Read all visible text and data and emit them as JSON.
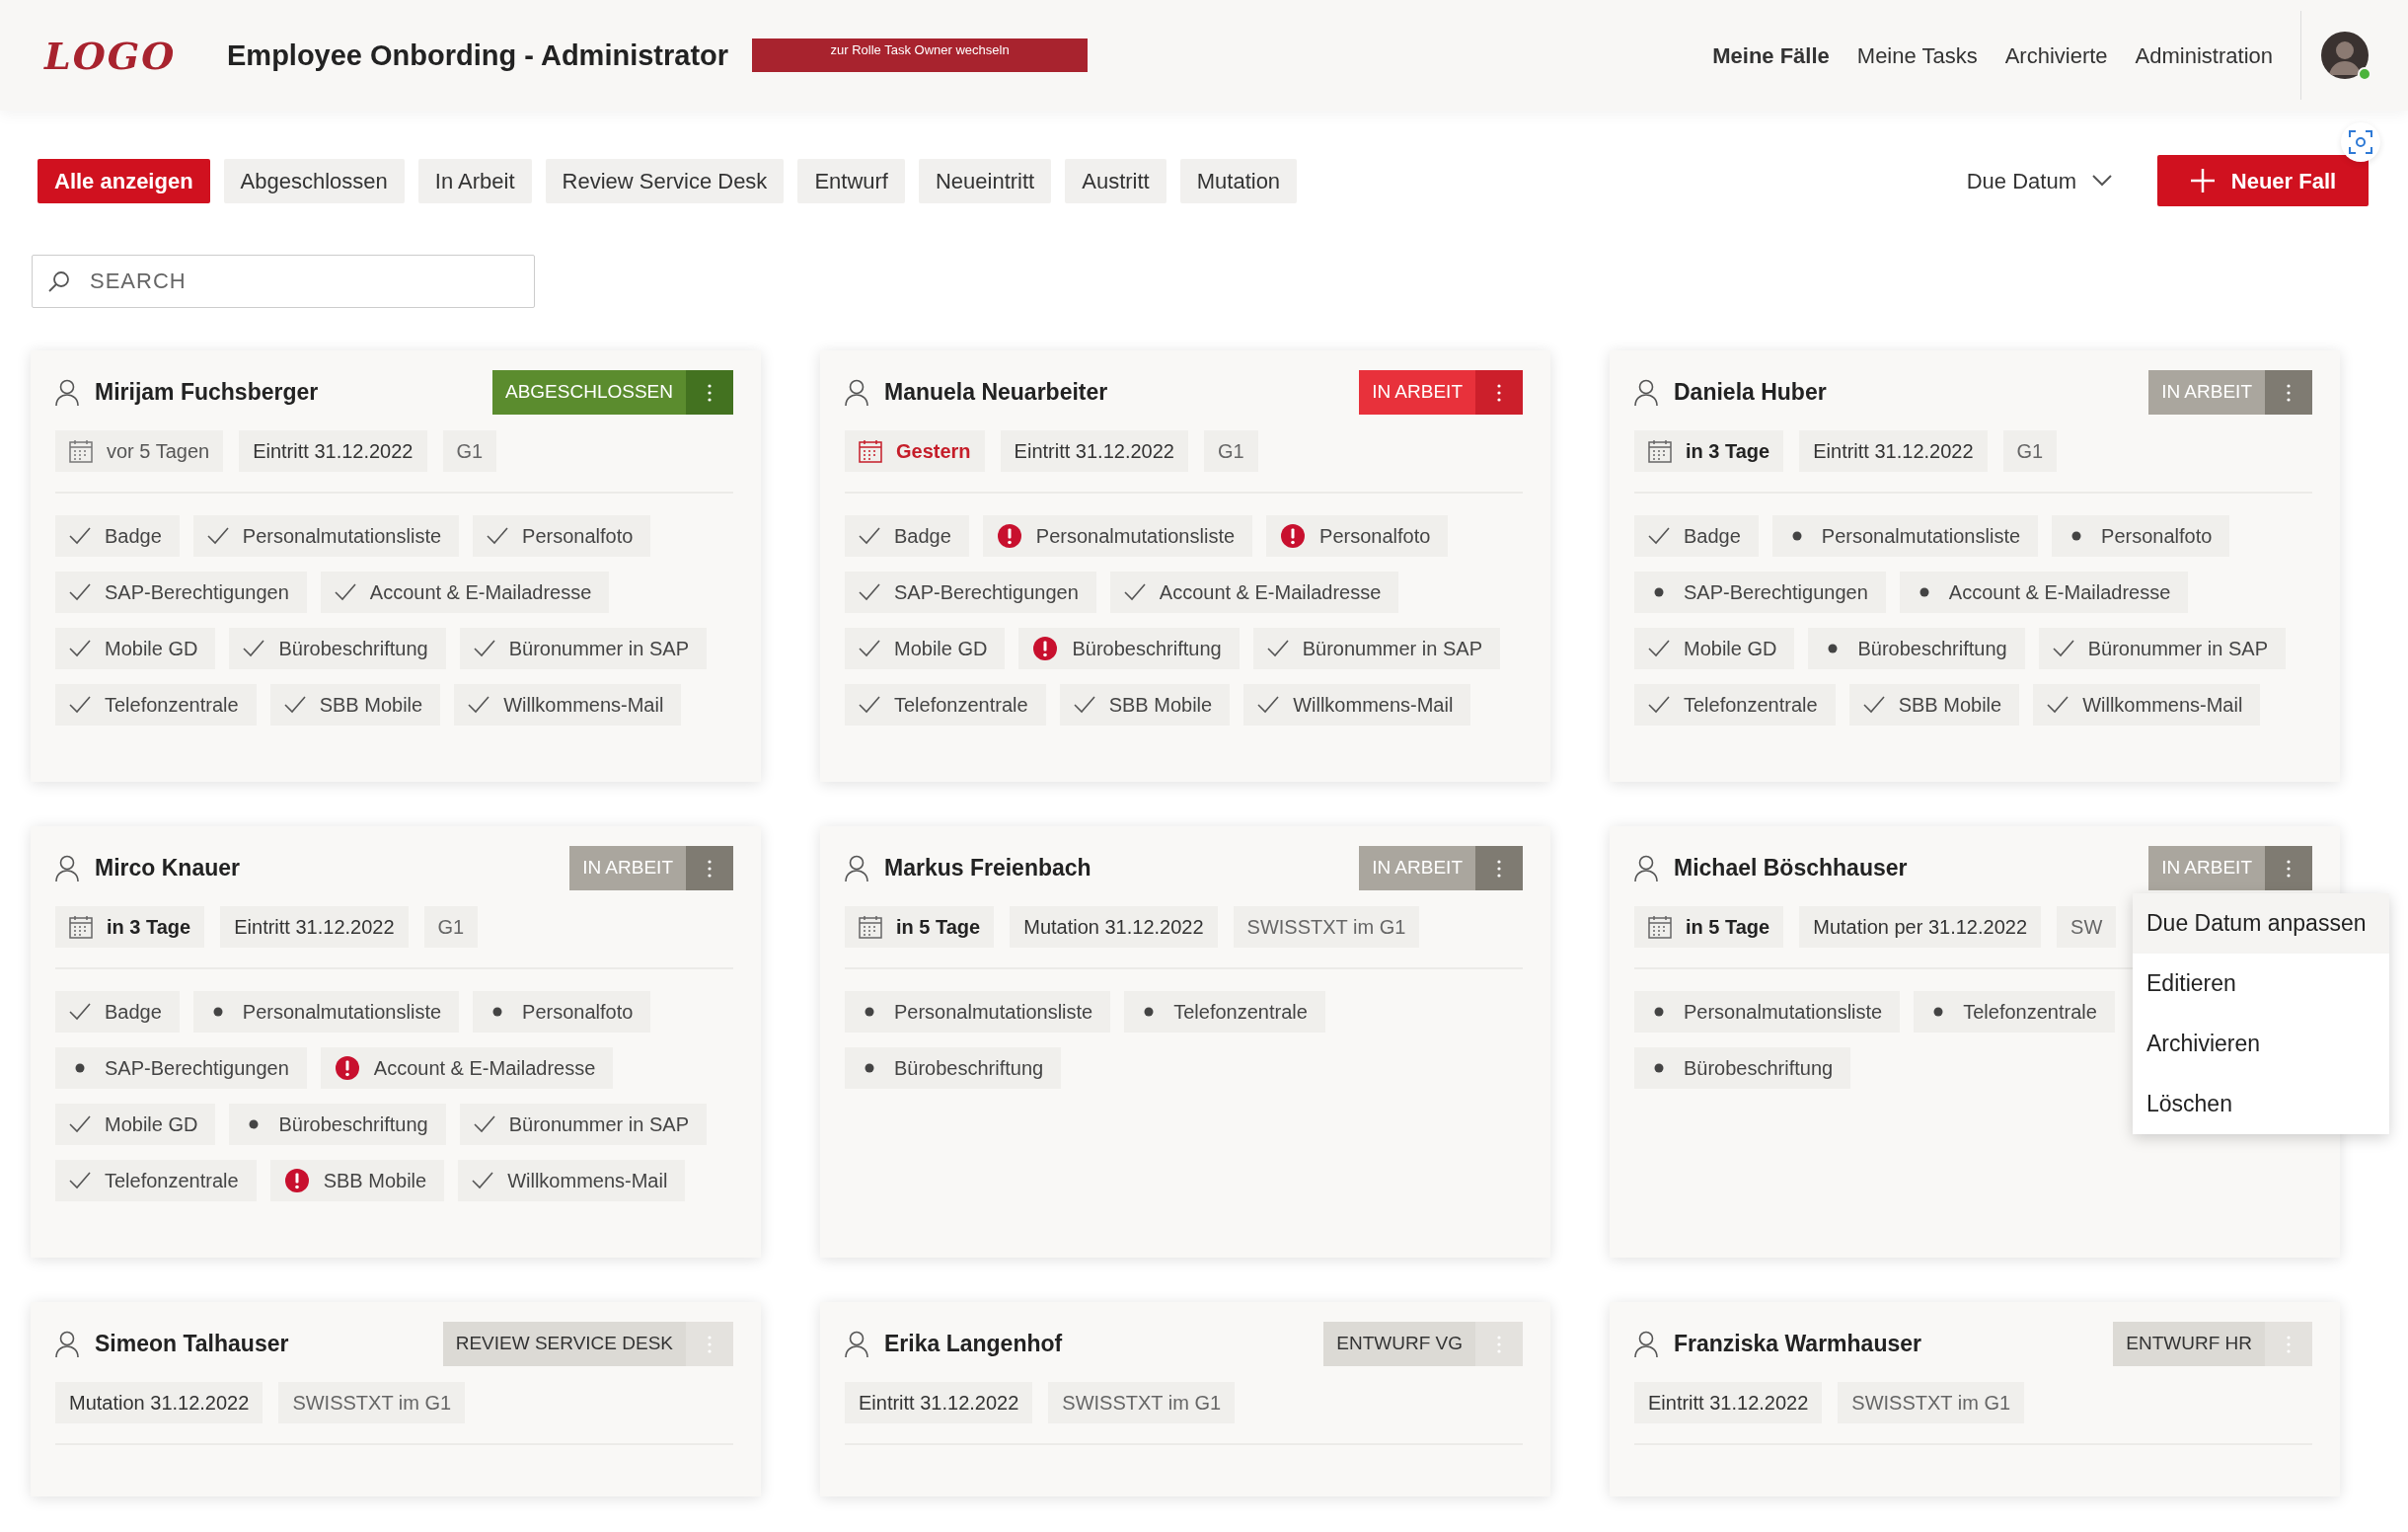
{
  "header": {
    "logo": "LOGO",
    "title": "Employee Onbording - Administrator",
    "role_button": "zur Rolle Task Owner wechseln",
    "nav": [
      {
        "label": "Meine Fälle",
        "selected": true
      },
      {
        "label": "Meine Tasks",
        "selected": false
      },
      {
        "label": "Archivierte",
        "selected": false
      },
      {
        "label": "Administration",
        "selected": false
      }
    ],
    "user_online": true
  },
  "filters": [
    {
      "label": "Alle anzeigen",
      "selected": true
    },
    {
      "label": "Abgeschlossen",
      "selected": false
    },
    {
      "label": "In Arbeit",
      "selected": false
    },
    {
      "label": "Review Service Desk",
      "selected": false
    },
    {
      "label": "Entwurf",
      "selected": false
    },
    {
      "label": "Neueintritt",
      "selected": false
    },
    {
      "label": "Austritt",
      "selected": false
    },
    {
      "label": "Mutation",
      "selected": false
    }
  ],
  "sort": {
    "label": "Due Datum"
  },
  "new_button": {
    "label": "Neuer Fall"
  },
  "search": {
    "placeholder": "SEARCH"
  },
  "cases": [
    {
      "name": "Mirijam Fuchsberger",
      "status": {
        "label": "ABGESCHLOSSEN",
        "kind": "done"
      },
      "due": {
        "text": "vor 5 Tagen",
        "kind": "past"
      },
      "meta": [
        {
          "text": "Eintritt 31.12.2022",
          "muted": false
        },
        {
          "text": "G1",
          "muted": true
        }
      ],
      "tasks": [
        {
          "label": "Badge",
          "kind": "done"
        },
        {
          "label": "Personalmutationsliste",
          "kind": "done"
        },
        {
          "label": "Personalfoto",
          "kind": "done"
        },
        {
          "label": "SAP-Berechtigungen",
          "kind": "done"
        },
        {
          "label": "Account & E-Mailadresse",
          "kind": "done"
        },
        {
          "label": "Mobile GD",
          "kind": "done"
        },
        {
          "label": "Bürobeschriftung",
          "kind": "done"
        },
        {
          "label": "Büronummer in SAP",
          "kind": "done"
        },
        {
          "label": "Telefonzentrale",
          "kind": "done"
        },
        {
          "label": "SBB Mobile",
          "kind": "done"
        },
        {
          "label": "Willkommens-Mail",
          "kind": "done"
        }
      ]
    },
    {
      "name": "Manuela Neuarbeiter",
      "status": {
        "label": "IN ARBEIT",
        "kind": "urgent"
      },
      "due": {
        "text": "Gestern",
        "kind": "overdue"
      },
      "meta": [
        {
          "text": "Eintritt 31.12.2022",
          "muted": false
        },
        {
          "text": "G1",
          "muted": true
        }
      ],
      "tasks": [
        {
          "label": "Badge",
          "kind": "done"
        },
        {
          "label": "Personalmutationsliste",
          "kind": "alert"
        },
        {
          "label": "Personalfoto",
          "kind": "alert"
        },
        {
          "label": "SAP-Berechtigungen",
          "kind": "done"
        },
        {
          "label": "Account & E-Mailadresse",
          "kind": "done"
        },
        {
          "label": "Mobile GD",
          "kind": "done"
        },
        {
          "label": "Bürobeschriftung",
          "kind": "alert"
        },
        {
          "label": "Büronummer in SAP",
          "kind": "done"
        },
        {
          "label": "Telefonzentrale",
          "kind": "done"
        },
        {
          "label": "SBB Mobile",
          "kind": "done"
        },
        {
          "label": "Willkommens-Mail",
          "kind": "done"
        }
      ]
    },
    {
      "name": "Daniela Huber",
      "status": {
        "label": "IN ARBEIT",
        "kind": "progress"
      },
      "due": {
        "text": "in 3 Tage",
        "kind": "upcoming"
      },
      "meta": [
        {
          "text": "Eintritt 31.12.2022",
          "muted": false
        },
        {
          "text": "G1",
          "muted": true
        }
      ],
      "tasks": [
        {
          "label": "Badge",
          "kind": "done"
        },
        {
          "label": "Personalmutationsliste",
          "kind": "open"
        },
        {
          "label": "Personalfoto",
          "kind": "open"
        },
        {
          "label": "SAP-Berechtigungen",
          "kind": "open"
        },
        {
          "label": "Account & E-Mailadresse",
          "kind": "open"
        },
        {
          "label": "Mobile GD",
          "kind": "done"
        },
        {
          "label": "Bürobeschriftung",
          "kind": "open"
        },
        {
          "label": "Büronummer in SAP",
          "kind": "done"
        },
        {
          "label": "Telefonzentrale",
          "kind": "done"
        },
        {
          "label": "SBB Mobile",
          "kind": "done"
        },
        {
          "label": "Willkommens-Mail",
          "kind": "done"
        }
      ]
    },
    {
      "name": "Mirco Knauer",
      "status": {
        "label": "IN ARBEIT",
        "kind": "progress"
      },
      "due": {
        "text": "in 3 Tage",
        "kind": "upcoming"
      },
      "meta": [
        {
          "text": "Eintritt 31.12.2022",
          "muted": false
        },
        {
          "text": "G1",
          "muted": true
        }
      ],
      "tasks": [
        {
          "label": "Badge",
          "kind": "done"
        },
        {
          "label": "Personalmutationsliste",
          "kind": "open"
        },
        {
          "label": "Personalfoto",
          "kind": "open"
        },
        {
          "label": "SAP-Berechtigungen",
          "kind": "open"
        },
        {
          "label": "Account & E-Mailadresse",
          "kind": "alert"
        },
        {
          "label": "Mobile GD",
          "kind": "done"
        },
        {
          "label": "Bürobeschriftung",
          "kind": "open"
        },
        {
          "label": "Büronummer in SAP",
          "kind": "done"
        },
        {
          "label": "Telefonzentrale",
          "kind": "done"
        },
        {
          "label": "SBB Mobile",
          "kind": "alert"
        },
        {
          "label": "Willkommens-Mail",
          "kind": "done"
        }
      ]
    },
    {
      "name": "Markus Freienbach",
      "status": {
        "label": "IN ARBEIT",
        "kind": "progress"
      },
      "due": {
        "text": "in 5 Tage",
        "kind": "upcoming"
      },
      "meta": [
        {
          "text": "Mutation 31.12.2022",
          "muted": false
        },
        {
          "text": "SWISSTXT im G1",
          "muted": true
        }
      ],
      "tasks": [
        {
          "label": "Personalmutationsliste",
          "kind": "open"
        },
        {
          "label": "Telefonzentrale",
          "kind": "open"
        },
        {
          "label": "Bürobeschriftung",
          "kind": "open"
        }
      ]
    },
    {
      "name": "Michael Böschhauser",
      "status": {
        "label": "IN ARBEIT",
        "kind": "progress"
      },
      "due": {
        "text": "in 5 Tage",
        "kind": "upcoming"
      },
      "meta": [
        {
          "text": "Mutation per 31.12.2022",
          "muted": false
        },
        {
          "text": "SW",
          "muted": true
        }
      ],
      "tasks": [
        {
          "label": "Personalmutationsliste",
          "kind": "open"
        },
        {
          "label": "Telefonzentrale",
          "kind": "open"
        },
        {
          "label": "Bürobeschriftung",
          "kind": "open"
        }
      ],
      "menu": [
        {
          "label": "Due Datum anpassen",
          "selected": true
        },
        {
          "label": "Editieren",
          "selected": false
        },
        {
          "label": "Archivieren",
          "selected": false
        },
        {
          "label": "Löschen",
          "selected": false
        }
      ]
    },
    {
      "name": "Simeon Talhauser",
      "status": {
        "label": "REVIEW SERVICE DESK",
        "kind": "draft"
      },
      "meta": [
        {
          "text": "Mutation 31.12.2022",
          "muted": false
        },
        {
          "text": "SWISSTXT im G1",
          "muted": true
        }
      ]
    },
    {
      "name": "Erika Langenhof",
      "status": {
        "label": "ENTWURF VG",
        "kind": "draft"
      },
      "meta": [
        {
          "text": "Eintritt 31.12.2022",
          "muted": false
        },
        {
          "text": "SWISSTXT im G1",
          "muted": true
        }
      ]
    },
    {
      "name": "Franziska Warmhauser",
      "status": {
        "label": "ENTWURF HR",
        "kind": "draft"
      },
      "meta": [
        {
          "text": "Eintritt 31.12.2022",
          "muted": false
        },
        {
          "text": "SWISSTXT im G1",
          "muted": true
        }
      ]
    }
  ]
}
